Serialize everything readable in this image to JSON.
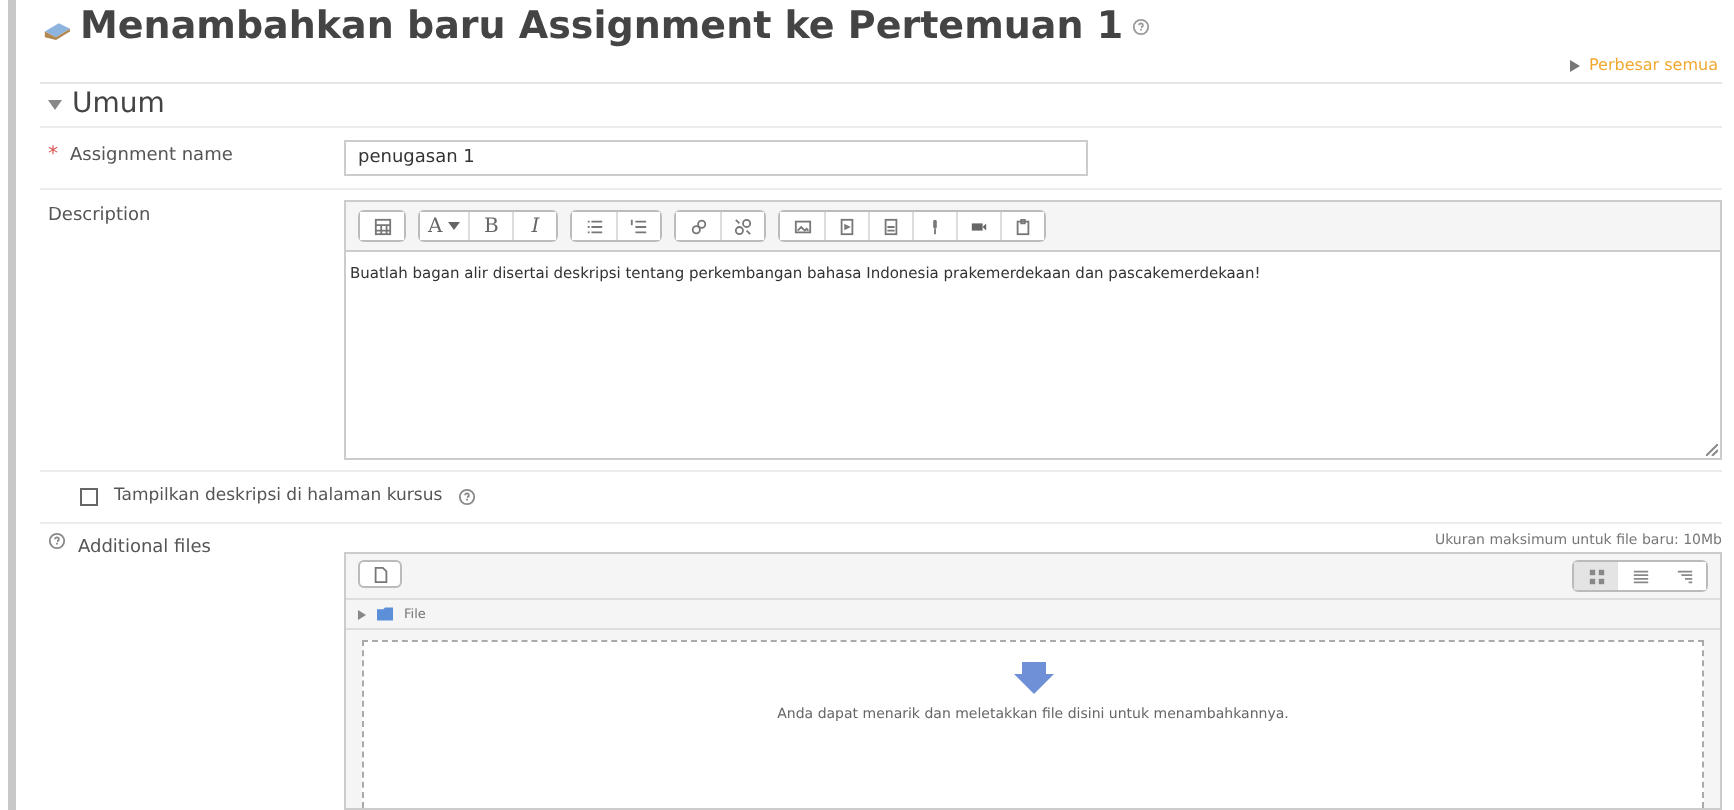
{
  "page_title": "Menambahkan baru Assignment ke Pertemuan 1",
  "expand_all": "Perbesar semua",
  "section": {
    "title": "Umum",
    "expanded": true
  },
  "assignment_name": {
    "label": "Assignment name",
    "required_marker": "*",
    "value": "penugasan 1"
  },
  "description": {
    "label": "Description",
    "text_buttons": [
      "A",
      "B",
      "I"
    ],
    "text": "Buatlah bagan alir disertai deskripsi tentang perkembangan bahasa Indonesia prakemerdekaan dan pascakemerdekaan!"
  },
  "show_description": {
    "label": "Tampilkan deskripsi di halaman kursus",
    "checked": false
  },
  "additional_files": {
    "label": "Additional files",
    "max_size": "Ukuran maksimum untuk file baru: 10Mb",
    "folder": "File",
    "drop_hint": "Anda dapat menarik dan meletakkan file disini untuk menambahkannya."
  }
}
